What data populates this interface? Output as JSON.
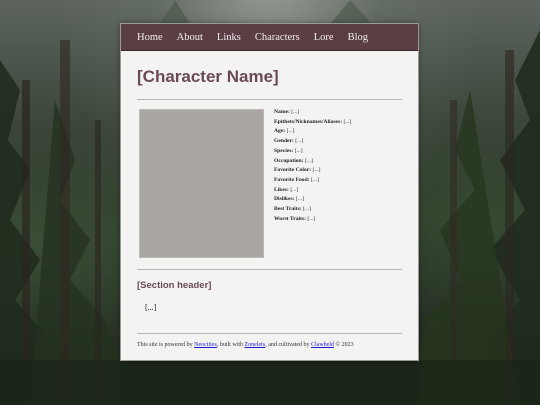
{
  "nav": {
    "items": [
      "Home",
      "About",
      "Links",
      "Characters",
      "Lore",
      "Blog"
    ]
  },
  "page_title": "[Character Name]",
  "profile": {
    "fields": [
      {
        "label": "Name:",
        "value": "[...]"
      },
      {
        "label": "Epithets/Nicknames/Aliases:",
        "value": "[...]"
      },
      {
        "label": "Age:",
        "value": "[...]"
      },
      {
        "label": "Gender:",
        "value": "[...]"
      },
      {
        "label": "Species:",
        "value": "[...]"
      },
      {
        "label": "Occupation:",
        "value": "[...]"
      },
      {
        "label": "Favorite Color:",
        "value": "[...]"
      },
      {
        "label": "Favorite Food:",
        "value": "[...]"
      },
      {
        "label": "Likes:",
        "value": "[...]"
      },
      {
        "label": "Dislikes:",
        "value": "[...]"
      },
      {
        "label": "Best Traits:",
        "value": "[...]"
      },
      {
        "label": "Worst Traits:",
        "value": "[...]"
      }
    ]
  },
  "section": {
    "header": "[Section header]",
    "body": "[...]"
  },
  "footer": {
    "prefix": "This site is powered by",
    "link1": "Neocities",
    "mid1": ", built with",
    "link2": "Zonelets",
    "mid2": ", and cultivated by",
    "link3": "Clawheld",
    "suffix": "© 2023"
  },
  "colors": {
    "nav_bg": "#5a3e44",
    "title_color": "#6b4b52",
    "page_bg": "#f3f3f2",
    "link_color": "#1a1acc",
    "portrait_placeholder": "#aaa6a3"
  }
}
